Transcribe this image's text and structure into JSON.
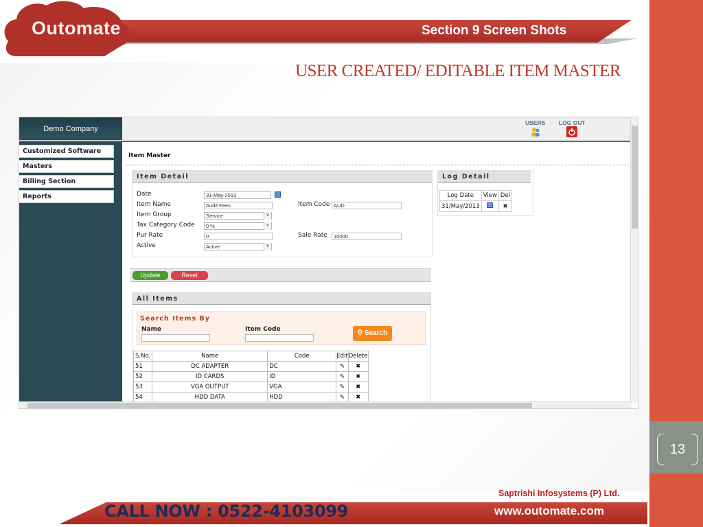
{
  "slide": {
    "section": "Section 9  Screen Shots",
    "title": "USER CREATED/ EDITABLE   ITEM  MASTER",
    "page_number": "13",
    "logo": "Outomate"
  },
  "footer": {
    "call": "CALL NOW :  0522-4103099",
    "company": "Saptrishi Infosystems (P) Ltd.",
    "website": "www.outomate.com"
  },
  "app": {
    "company": "Demo Company",
    "sidebar": {
      "items": [
        {
          "label": "Customized Software"
        },
        {
          "label": "Masters"
        },
        {
          "label": "Billing Section"
        },
        {
          "label": "Reports"
        }
      ]
    },
    "topbar": {
      "users": "USERS",
      "logout": "LOG OUT"
    },
    "page_title": "Item Master",
    "item_detail": {
      "heading": "Item Detail",
      "date_label": "Date",
      "date": "31-May-2013",
      "name_label": "Item Name",
      "name": "Audit Fees",
      "code_label": "Item Code",
      "code": "AUD",
      "group_label": "Item Group",
      "group": "Service",
      "tax_label": "Tax Category Code",
      "tax": "0 %",
      "pur_label": "Pur Rate",
      "pur": "0",
      "sale_label": "Sale Rate",
      "sale": "10000",
      "active_label": "Active",
      "active": "Active"
    },
    "buttons": {
      "update": "Update",
      "reset": "Reset"
    },
    "log": {
      "heading": "Log Detail",
      "cols": [
        "Log Date",
        "View",
        "Del"
      ],
      "rows": [
        {
          "date": "31/May/2013"
        }
      ]
    },
    "all_items": {
      "heading": "All Items",
      "search_heading": "Search Items By",
      "name_label": "Name",
      "code_label": "Item Code",
      "search_button": "Search",
      "cols": [
        "S.No.",
        "Name",
        "Code",
        "Edit",
        "Delete"
      ],
      "rows": [
        {
          "sno": "51",
          "name": "DC ADAPTER",
          "code": "DC"
        },
        {
          "sno": "52",
          "name": "ID CARDS",
          "code": "ID"
        },
        {
          "sno": "53",
          "name": "VGA OUTPUT",
          "code": "VGA"
        },
        {
          "sno": "54",
          "name": "HDD DATA",
          "code": "HDD"
        }
      ]
    }
  },
  "colors": {
    "accent": "#d9573e",
    "sidebar": "#2a4b55",
    "title": "#c0392b"
  }
}
